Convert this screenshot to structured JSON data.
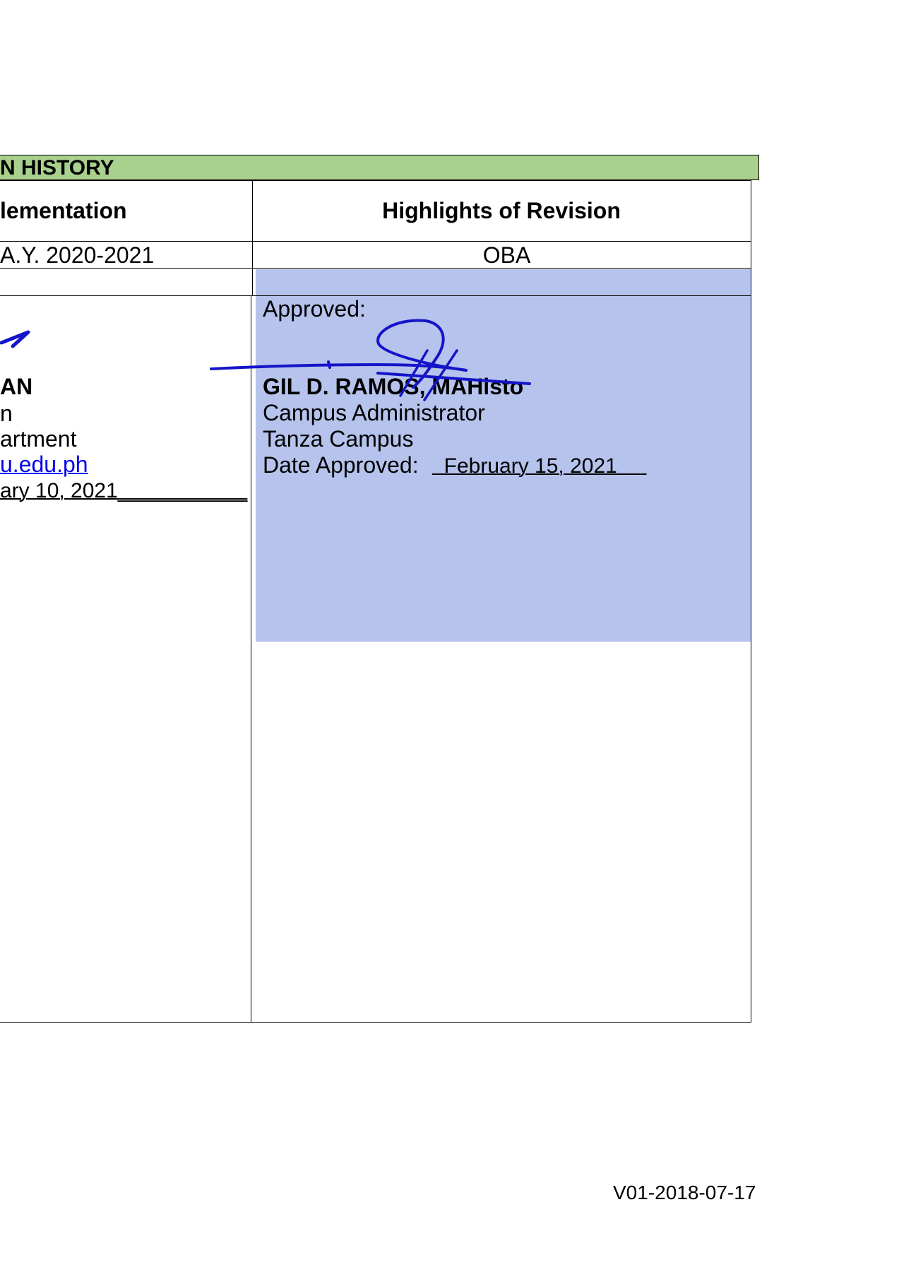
{
  "header": {
    "title": "N HISTORY"
  },
  "columns": {
    "left_header": "lementation",
    "right_header": "Highlights of Revision"
  },
  "row1": {
    "left": "A.Y. 2020-2021",
    "right": "OBA"
  },
  "left_block": {
    "name": "AN",
    "line1": "n",
    "line2": "artment",
    "email": "u.edu.ph",
    "date": "ary 10, 2021___________"
  },
  "right_block": {
    "approved_label": "Approved:",
    "name": "GIL D. RAMOS, MAHisto",
    "position": "Campus Administrator",
    "campus": "Tanza Campus",
    "date_label": "Date Approved:",
    "date_value": "  February 15, 2021     "
  },
  "footer": {
    "version": "V01-2018-07-17"
  },
  "colors": {
    "header_band": "#a9d18e",
    "highlight": "#b6c3ec",
    "signature_ink": "#1414c8",
    "link": "#0000ee"
  }
}
